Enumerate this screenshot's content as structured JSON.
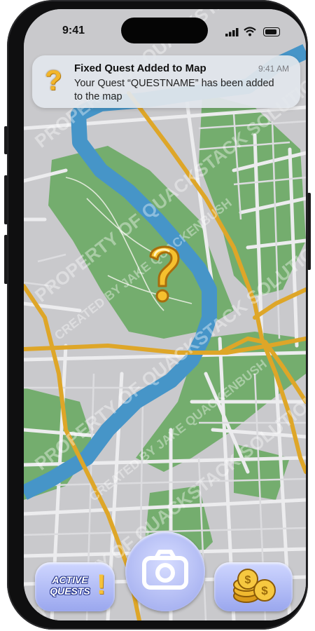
{
  "status_bar": {
    "time": "9:41"
  },
  "notification": {
    "title": "Fixed Quest Added to Map",
    "time": "9:41 AM",
    "body": "Your Quest “QUESTNAME” has been added to the map",
    "icon": "question-mark-icon"
  },
  "map": {
    "colors": {
      "land": "#c9c9cc",
      "park": "#74ad6e",
      "river": "#4695c8",
      "road_major": "#dea628",
      "road_minor": "#eaeaec"
    },
    "quest_marker_icon": "question-mark-icon"
  },
  "bottom_bar": {
    "active_quests_line1": "ACTIVE",
    "active_quests_line2": "QUESTS",
    "active_quests_mark": "!",
    "camera_icon": "camera-icon",
    "coins_icon": "coins-icon"
  },
  "watermarks": {
    "line_a": "PROPERTY OF QUACKSTACK SOLUTIONS",
    "line_b": "CREATED BY JAKE QUACKENBUSH"
  }
}
